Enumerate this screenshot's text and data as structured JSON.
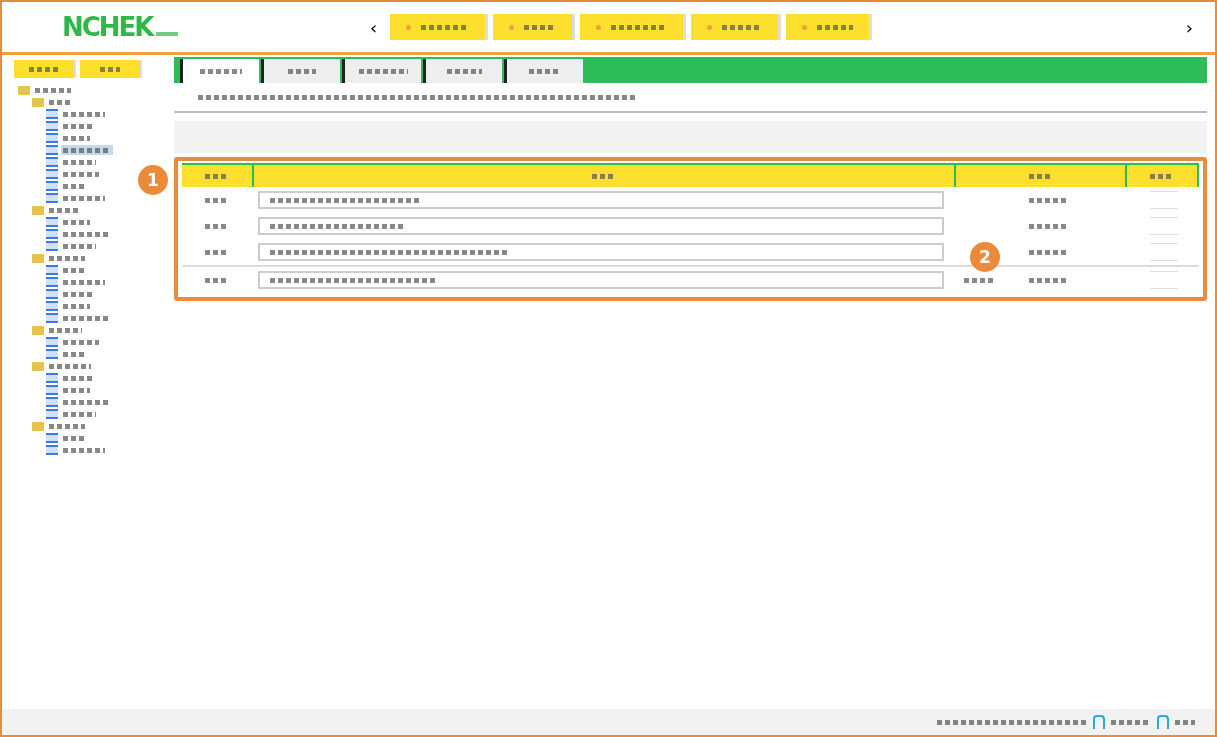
{
  "header": {
    "logo": "NCHEK",
    "prev": "‹",
    "next": "›",
    "nav_buttons": [
      {
        "kind": "blurred"
      },
      {
        "kind": "blurred"
      },
      {
        "kind": "blurred"
      },
      {
        "kind": "blurred"
      },
      {
        "kind": "blurred"
      }
    ]
  },
  "sidebar": {
    "buttons": [
      {
        "kind": "blurred"
      },
      {
        "kind": "blurred"
      }
    ],
    "tree": [
      {
        "kind": "folder",
        "selected": false,
        "children": [
          {
            "kind": "folder",
            "selected": false,
            "children": [
              {
                "kind": "page",
                "selected": false
              },
              {
                "kind": "page",
                "selected": false
              },
              {
                "kind": "page",
                "selected": false
              },
              {
                "kind": "page",
                "selected": true
              },
              {
                "kind": "page",
                "selected": false
              },
              {
                "kind": "page",
                "selected": false
              },
              {
                "kind": "page",
                "selected": false
              },
              {
                "kind": "page",
                "selected": false
              }
            ]
          },
          {
            "kind": "folder",
            "selected": false,
            "children": [
              {
                "kind": "page",
                "selected": false
              },
              {
                "kind": "page",
                "selected": false
              },
              {
                "kind": "page",
                "selected": false
              }
            ]
          },
          {
            "kind": "folder",
            "selected": false,
            "children": [
              {
                "kind": "page",
                "selected": false
              },
              {
                "kind": "page",
                "selected": false
              },
              {
                "kind": "page",
                "selected": false
              },
              {
                "kind": "page",
                "selected": false
              },
              {
                "kind": "page",
                "selected": false
              }
            ]
          },
          {
            "kind": "folder",
            "selected": false,
            "children": [
              {
                "kind": "page",
                "selected": false
              },
              {
                "kind": "page",
                "selected": false
              }
            ]
          },
          {
            "kind": "folder",
            "selected": false,
            "children": [
              {
                "kind": "page",
                "selected": false
              },
              {
                "kind": "page",
                "selected": false
              },
              {
                "kind": "page",
                "selected": false
              },
              {
                "kind": "page",
                "selected": false
              }
            ]
          },
          {
            "kind": "folder",
            "selected": false,
            "children": [
              {
                "kind": "page",
                "selected": false
              },
              {
                "kind": "page",
                "selected": false
              }
            ]
          }
        ]
      }
    ]
  },
  "tabs": [
    {
      "selected": true
    },
    {
      "selected": false
    },
    {
      "selected": false
    },
    {
      "selected": false
    },
    {
      "selected": false
    }
  ],
  "table": {
    "columns": [
      {
        "kind": "blurred"
      },
      {
        "kind": "blurred"
      },
      {
        "kind": "blurred"
      },
      {
        "kind": "blurred"
      }
    ],
    "rows": [
      {
        "extra": false
      },
      {
        "extra": false
      },
      {
        "extra": false
      },
      {
        "extra": true
      }
    ]
  },
  "callouts": [
    "1",
    "2"
  ]
}
